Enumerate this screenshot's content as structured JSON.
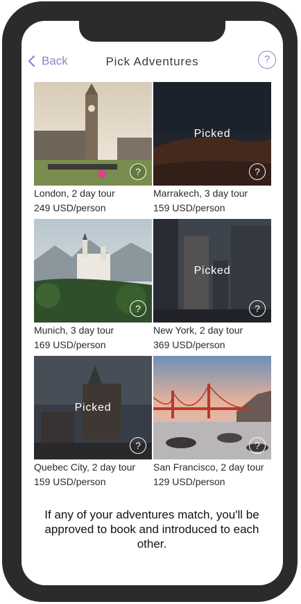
{
  "nav": {
    "back_label": "Back",
    "title": "Pick Adventures",
    "help_symbol": "?"
  },
  "tours": [
    {
      "name": "London, 2 day tour",
      "price": "249 USD/person",
      "picked": false,
      "picked_label": "",
      "icon": "help-icon"
    },
    {
      "name": "Marrakech, 3 day tour",
      "price": "159 USD/person",
      "picked": true,
      "picked_label": "Picked",
      "icon": "help-icon"
    },
    {
      "name": "Munich, 3 day tour",
      "price": "169 USD/person",
      "picked": false,
      "picked_label": "",
      "icon": "help-icon"
    },
    {
      "name": "New York, 2 day tour",
      "price": "369 USD/person",
      "picked": true,
      "picked_label": "Picked",
      "icon": "help-icon"
    },
    {
      "name": "Quebec City, 2 day tour",
      "price": "159 USD/person",
      "picked": true,
      "picked_label": "Picked",
      "icon": "help-icon"
    },
    {
      "name": "San Francisco, 2 day tour",
      "price": "129 USD/person",
      "picked": false,
      "picked_label": "",
      "icon": "help-icon"
    }
  ],
  "footer": {
    "message": "If any of your adventures match, you'll be approved to book and introduced to each other."
  },
  "colors": {
    "accent": "#8a85c9",
    "phone_frame": "#2b2b2b"
  }
}
